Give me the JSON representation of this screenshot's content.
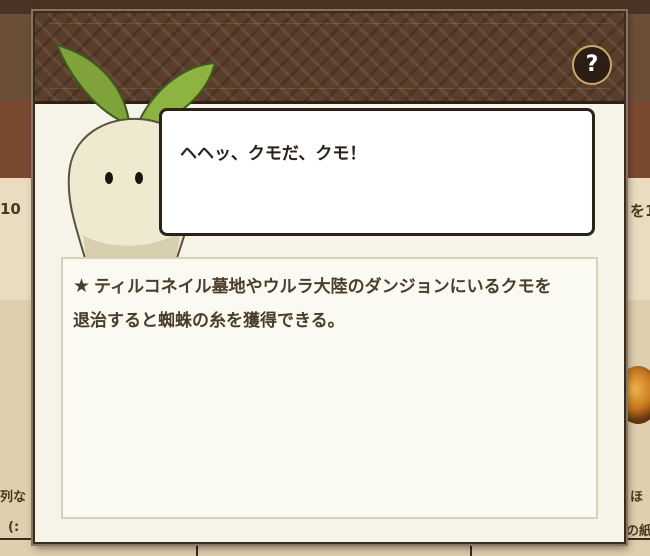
{
  "background": {
    "left_fragments": [
      "10",
      "列な",
      "(:"
    ],
    "right_fragments": [
      "を1",
      "ほ",
      "の紙"
    ]
  },
  "popup": {
    "help_label": "?",
    "speech": "ヘヘッ、クモだ、クモ！",
    "description_star": "★",
    "description": "ティルコネイル墓地やウルラ大陸のダンジョンにいるクモを退治すると蜘蛛の糸を獲得できる。"
  }
}
